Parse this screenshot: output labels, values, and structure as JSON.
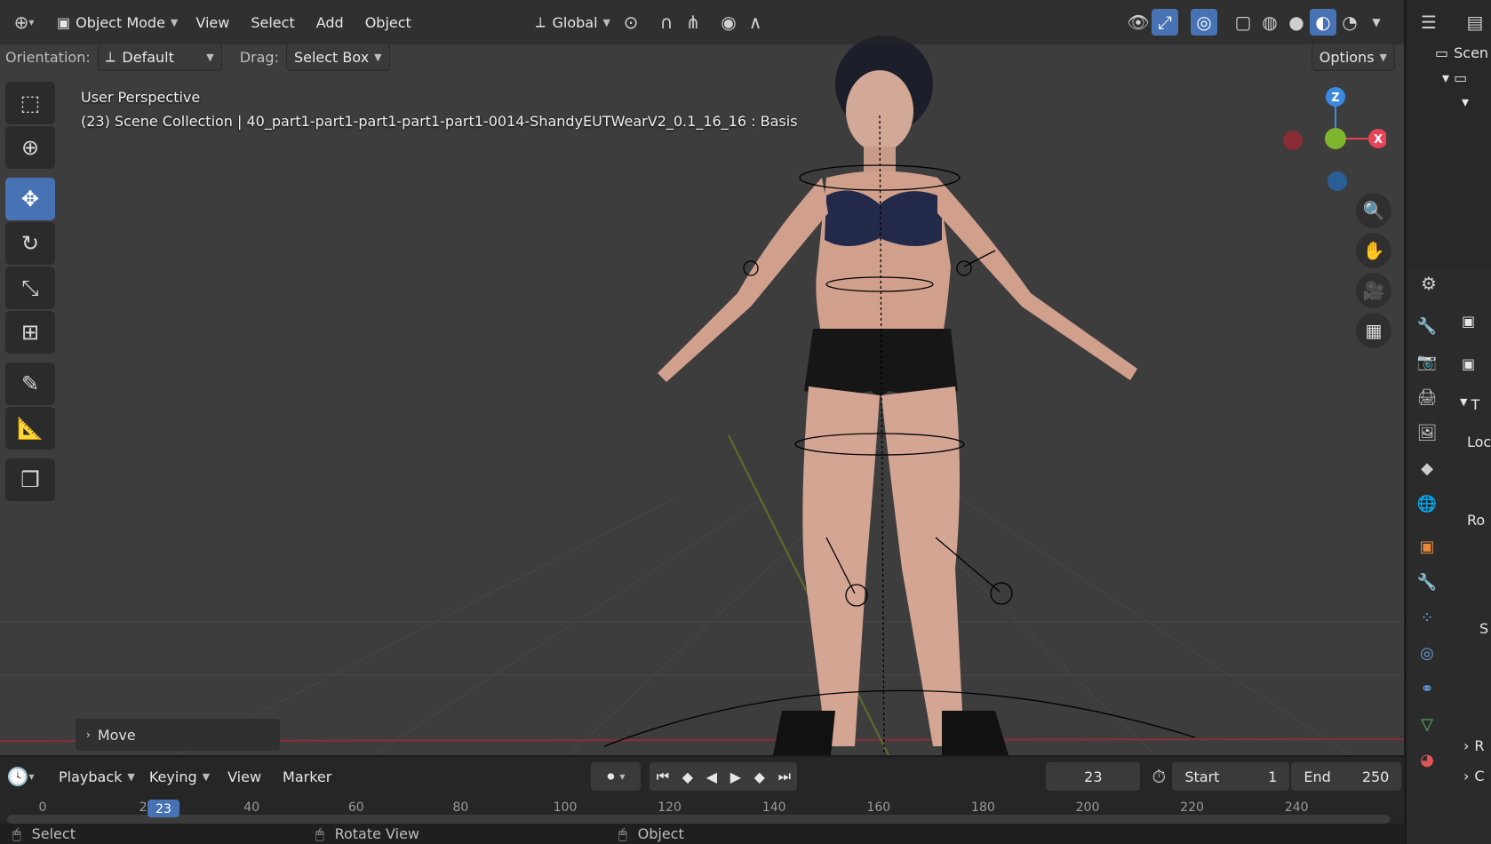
{
  "header": {
    "editor_icon": "viewport-editor-icon",
    "mode": "Object Mode",
    "menus": [
      "View",
      "Select",
      "Add",
      "Object"
    ],
    "transform_orientation": "Global",
    "options_label": "Options"
  },
  "tool_settings": {
    "orientation_label": "Orientation:",
    "orientation_value": "Default",
    "drag_label": "Drag:",
    "drag_value": "Select Box"
  },
  "viewport": {
    "view_name": "User Perspective",
    "scene_info": "(23) Scene Collection | 40_part1-part1-part1-part1-part1-0014-ShandyEUTWearV2_0.1_16_16 : Basis",
    "axis_labels": {
      "z": "Z",
      "x": "X"
    },
    "last_operator": "Move"
  },
  "outliner": {
    "item_0": "Scen"
  },
  "properties": {
    "labels": [
      "T",
      "Loc",
      "Ro",
      "S",
      "R",
      "C"
    ]
  },
  "timeline": {
    "menus": [
      "Playback",
      "Keying",
      "View",
      "Marker"
    ],
    "current_frame": "23",
    "start_label": "Start",
    "start_value": "1",
    "end_label": "End",
    "end_value": "250",
    "ticks": [
      "0",
      "20",
      "40",
      "60",
      "80",
      "100",
      "120",
      "140",
      "160",
      "180",
      "200",
      "220",
      "240"
    ],
    "playhead": "23"
  },
  "status_bar": {
    "left": "Select",
    "middle": "Rotate View",
    "right": "Object"
  },
  "colors": {
    "accent": "#4772b3",
    "viewport_bg": "#3d3d3d",
    "axis_x": "#e84458",
    "axis_y": "#7db52e",
    "axis_z": "#3a8ae0"
  }
}
